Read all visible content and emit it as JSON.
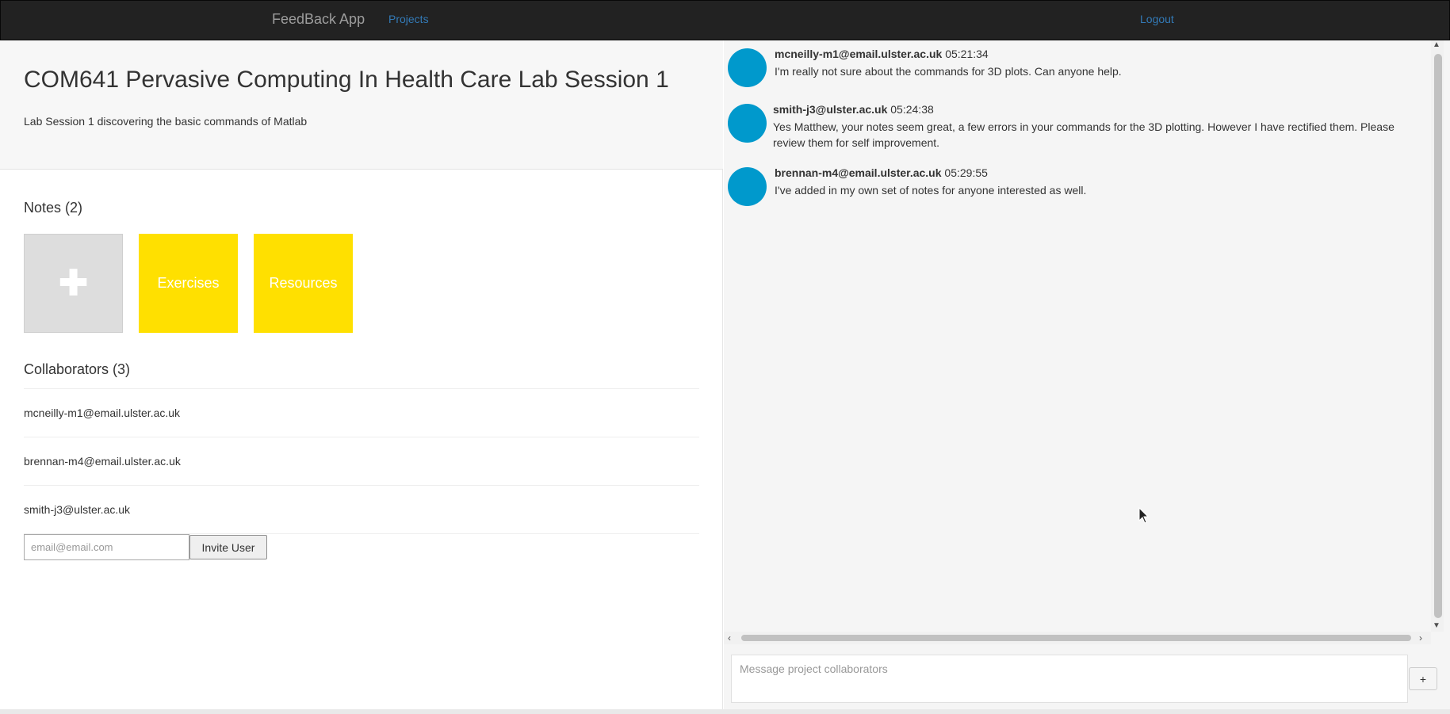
{
  "navbar": {
    "brand": "FeedBack App",
    "projects_link": "Projects",
    "logout_link": "Logout"
  },
  "project": {
    "title": "COM641 Pervasive Computing In Health Care Lab Session 1",
    "description": "Lab Session 1 discovering the basic commands of Matlab"
  },
  "notes": {
    "heading": "Notes (2)",
    "add_icon": "plus-icon",
    "items": [
      {
        "label": "Exercises",
        "color": "#ffe000"
      },
      {
        "label": "Resources",
        "color": "#ffe000"
      }
    ]
  },
  "collaborators": {
    "heading": "Collaborators (3)",
    "items": [
      "mcneilly-m1@email.ulster.ac.uk",
      "brennan-m4@email.ulster.ac.uk",
      "smith-j3@ulster.ac.uk"
    ],
    "invite_placeholder": "email@email.com",
    "invite_button": "Invite User"
  },
  "chat": {
    "avatar_color": "#0099cc",
    "messages": [
      {
        "author": "mcneilly-m1@email.ulster.ac.uk",
        "time": "05:21:34",
        "text": "I'm really not sure about the commands for 3D plots. Can anyone help."
      },
      {
        "author": "smith-j3@ulster.ac.uk",
        "time": "05:24:38",
        "text": "Yes Matthew, your notes seem great, a few errors in your commands for the 3D plotting. However I have rectified them. Please review them for self improvement."
      },
      {
        "author": "brennan-m4@email.ulster.ac.uk",
        "time": "05:29:55",
        "text": "I've added in my own set of notes for anyone interested as well."
      }
    ],
    "composer_placeholder": "Message project collaborators",
    "send_button": "+"
  }
}
